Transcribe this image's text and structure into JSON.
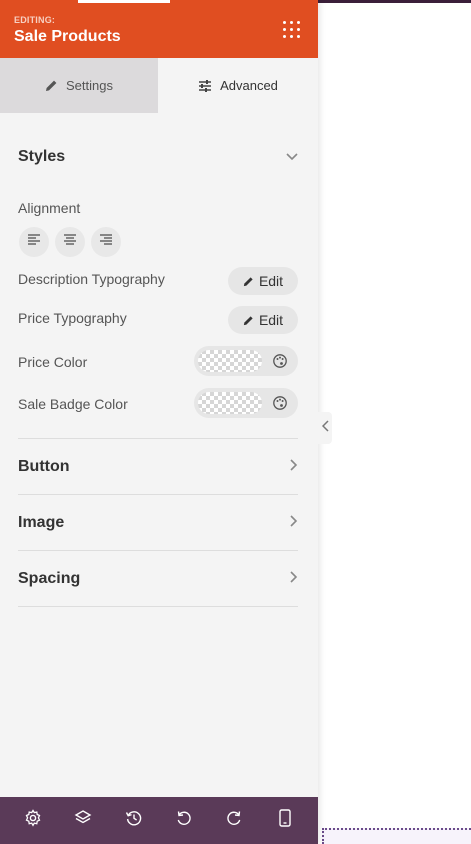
{
  "header": {
    "editing_label": "EDITING:",
    "title": "Sale Products",
    "menu_icon": "grid-dots-icon"
  },
  "tabs": [
    {
      "label": "Settings",
      "icon": "pencil-icon",
      "active": true
    },
    {
      "label": "Advanced",
      "icon": "sliders-icon",
      "active": false
    }
  ],
  "styles_section": {
    "title": "Styles",
    "expanded": true,
    "alignment": {
      "label": "Alignment",
      "options": [
        "align-left-icon",
        "align-center-icon",
        "align-right-icon"
      ]
    },
    "description_typography": {
      "label": "Description Typography",
      "button": "Edit"
    },
    "price_typography": {
      "label": "Price Typography",
      "button": "Edit"
    },
    "price_color": {
      "label": "Price Color",
      "value": "transparent"
    },
    "sale_badge_color": {
      "label": "Sale Badge Color",
      "value": "transparent"
    }
  },
  "sections": [
    {
      "title": "Button",
      "expanded": false
    },
    {
      "title": "Image",
      "expanded": false
    },
    {
      "title": "Spacing",
      "expanded": false
    }
  ],
  "footer": {
    "buttons": [
      "gear-icon",
      "layers-icon",
      "history-icon",
      "undo-icon",
      "redo-icon",
      "mobile-icon"
    ]
  },
  "colors": {
    "header": "#e04e21",
    "footer": "#5a3a58",
    "panel": "#f4f4f4",
    "active_tab": "#dcdadc"
  }
}
